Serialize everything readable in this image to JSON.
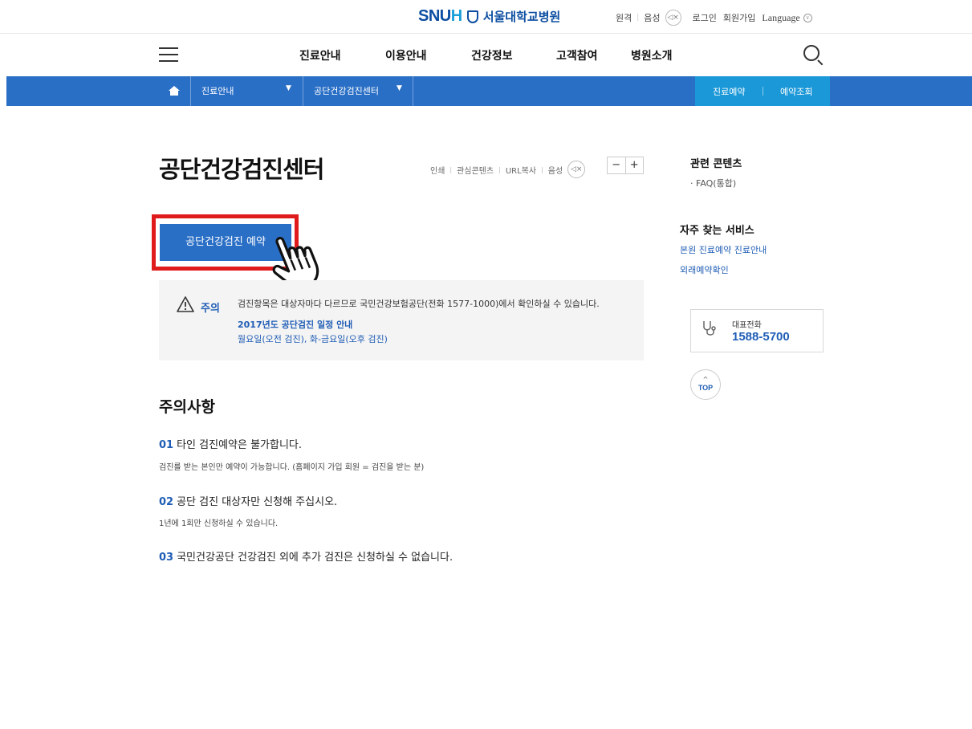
{
  "brand": {
    "logo_en_main": "SNU",
    "logo_en_accent": "H",
    "logo_kr": "서울대학교병원"
  },
  "util": {
    "remote": "원격",
    "voice": "음성",
    "sound_icon": "speaker-mute-icon",
    "login": "로그인",
    "join": "회원가입",
    "language": "Language"
  },
  "gnb": {
    "menu": [
      "진료안내",
      "이용안내",
      "건강정보",
      "고객참여",
      "병원소개"
    ]
  },
  "location": {
    "crumb1": "진료안내",
    "crumb2": "공단건강검진센터",
    "quick1": "진료예약",
    "quick2": "예약조회"
  },
  "page": {
    "title": "공단건강검진센터",
    "tools": {
      "print": "인쇄",
      "favorite": "관심콘텐츠",
      "url_copy": "URL복사",
      "voice": "음성"
    },
    "zoom_out": "−",
    "zoom_in": "+"
  },
  "reserve": {
    "label": "공단건강검진 예약"
  },
  "notice": {
    "label": "주의",
    "text": "검진항목은 대상자마다 다르므로 국민건강보험공단(전화 1577-1000)에서 확인하실 수 있습니다.",
    "link1": "2017년도 공단검진 일정 안내",
    "link2": "월요일(오전 검진), 화-금요일(오후 검진)"
  },
  "cautions": {
    "title": "주의사항",
    "items": [
      {
        "num": "01",
        "head": "타인 검진예약은 불가합니다.",
        "desc": "검진를 받는 본인만 예약이 가능합니다. (홈페이지 가입 회원 = 검진을 받는 분)"
      },
      {
        "num": "02",
        "head": "공단 검진 대상자만 신청해 주십시오.",
        "desc": "1년에 1회만 신청하실 수 있습니다."
      },
      {
        "num": "03",
        "head": "국민건강공단 건강검진 외에 추가 검진은 신청하실 수 없습니다.",
        "desc": ""
      }
    ]
  },
  "sidebar": {
    "related_title": "관련 콘텐츠",
    "faq": "FAQ(통합)",
    "services_title": "자주 찾는 서비스",
    "service_row1": "본원 진료예약 진료안내",
    "service_row2": "외래예약확인",
    "phone_label": "대표전화",
    "phone_number": "1588-5700",
    "top": "TOP"
  },
  "colors": {
    "primary_blue": "#2a6fc6",
    "accent_cyan": "#1b98d8",
    "highlight_red": "#e01b1b",
    "link_blue": "#1f5db5"
  }
}
